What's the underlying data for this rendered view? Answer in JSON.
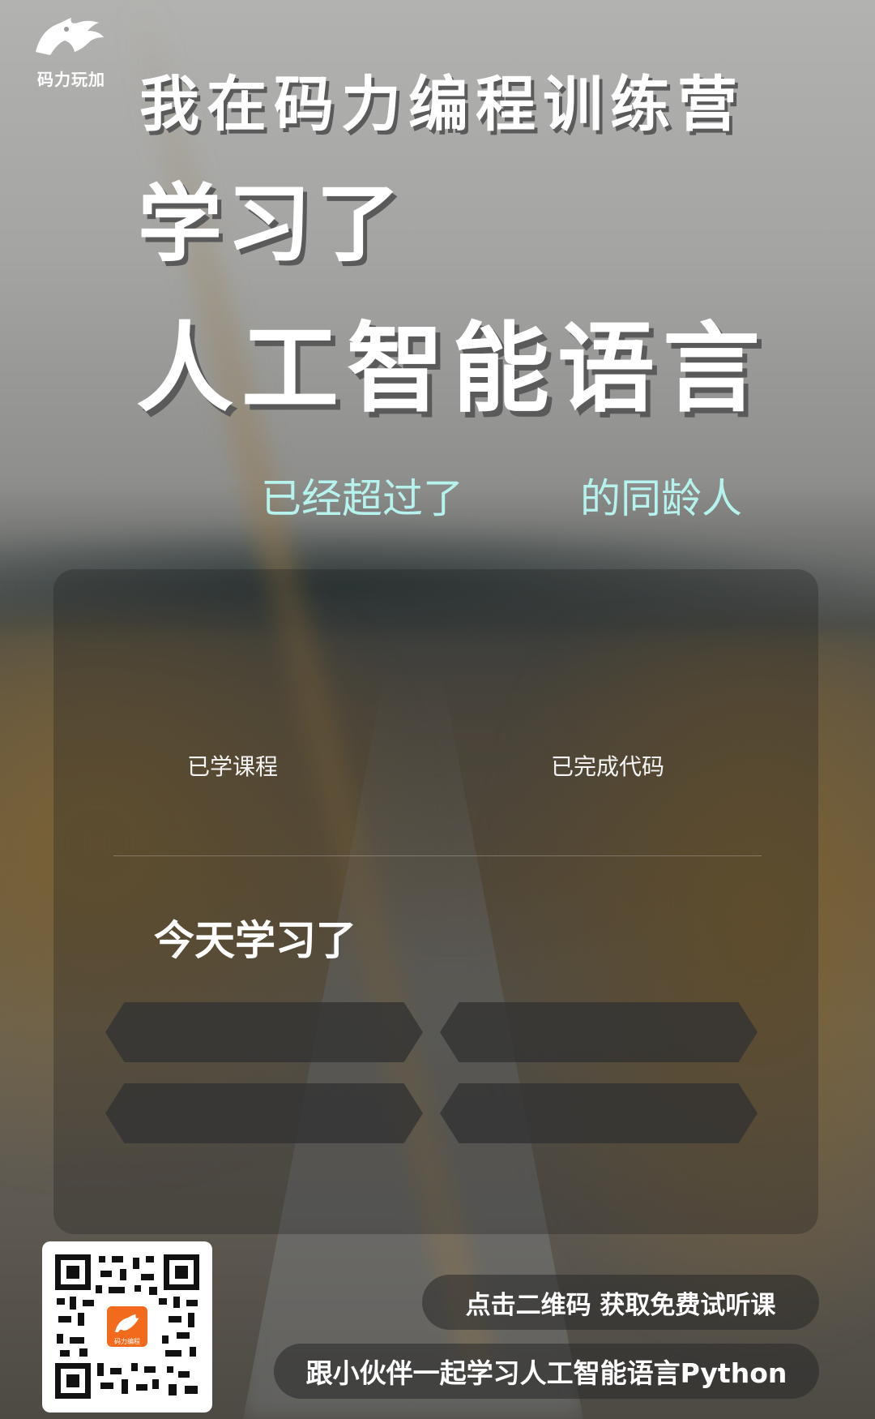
{
  "brand": {
    "logo_text": "码力玩加"
  },
  "header": {
    "line1": "我在码力编程训练营",
    "line2": "学习了",
    "line3": "人工智能语言"
  },
  "ranking": {
    "prefix": "已经超过了",
    "suffix": "的同龄人"
  },
  "stats": {
    "courses_label": "已学课程",
    "code_label": "已完成代码"
  },
  "today": {
    "title": "今天学习了"
  },
  "footer": {
    "cta_label": "点击二维码 获取免费试听课",
    "slogan": "跟小伙伴一起学习人工智能语言Python",
    "qr_badge": "码力编程"
  },
  "colors": {
    "accent_text": "#b6f3ee",
    "qr_badge": "#f26a1b"
  }
}
